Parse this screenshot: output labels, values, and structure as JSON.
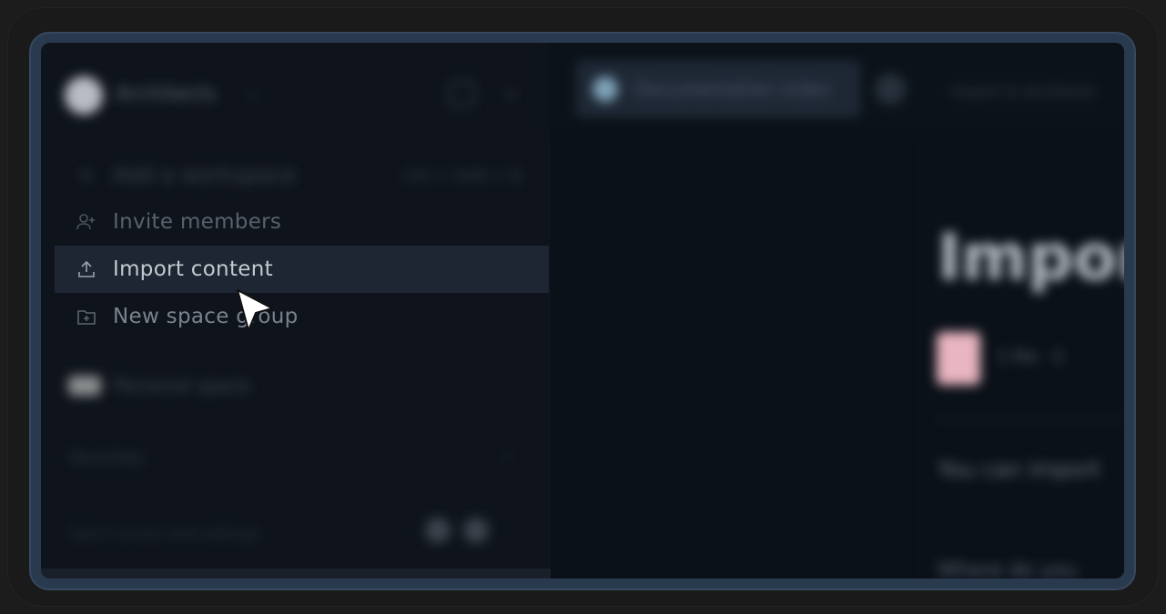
{
  "workspace": {
    "name": "Architects",
    "avatar_color": "#b8bcc4"
  },
  "sidebar": {
    "items": [
      {
        "label": "Add a workspace",
        "shortcut": "Ctrl + Shift + N"
      },
      {
        "label": "Invite members"
      },
      {
        "label": "Import content"
      },
      {
        "label": "New space group"
      }
    ],
    "personal_label": "Personal space",
    "section_label": "Favorites",
    "footer_label": "Quick access and settings"
  },
  "tabs": {
    "active_label": "Documentation index",
    "right_label": "Import to Architects"
  },
  "main": {
    "title": "Import",
    "file_meta": "1 file · 2",
    "body_text": "You can import",
    "body_text2": "Where do you"
  },
  "colors": {
    "accent_highlight": "#1d2632",
    "frame": "#2a3a4e",
    "background": "#0c121a"
  }
}
